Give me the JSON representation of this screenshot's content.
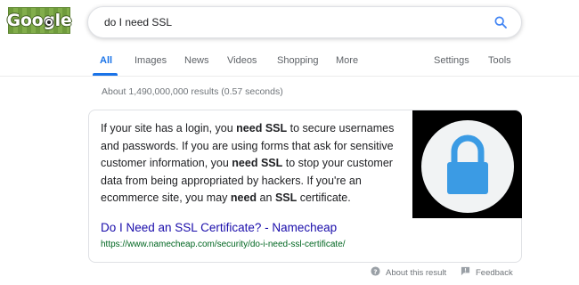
{
  "logo": {
    "text": "Google"
  },
  "search": {
    "query": "do I need SSL"
  },
  "tabs": [
    {
      "label": "All"
    },
    {
      "label": "Images"
    },
    {
      "label": "News"
    },
    {
      "label": "Videos"
    },
    {
      "label": "Shopping"
    },
    {
      "label": "More"
    }
  ],
  "tools": {
    "settings": "Settings",
    "tools": "Tools"
  },
  "results": {
    "stats": "About 1,490,000,000 results (0.57 seconds)"
  },
  "snippet": {
    "segments": [
      {
        "text": "If your site has a login, you "
      },
      {
        "text": "need SSL",
        "bold": true
      },
      {
        "text": " to secure usernames and passwords. If you are using forms that ask for sensitive customer information, you "
      },
      {
        "text": "need SSL",
        "bold": true
      },
      {
        "text": " to stop your customer data from being appropriated by hackers. If you're an ecommerce site, you may "
      },
      {
        "text": "need",
        "bold": true
      },
      {
        "text": " an "
      },
      {
        "text": "SSL",
        "bold": true
      },
      {
        "text": " certificate."
      }
    ],
    "title": "Do I Need an SSL Certificate? - Namecheap",
    "url": "https://www.namecheap.com/security/do-i-need-ssl-certificate/",
    "image_icon": "padlock-icon"
  },
  "footer": {
    "about": "About this result",
    "feedback": "Feedback"
  },
  "colors": {
    "accent": "#1a73e8",
    "link_title": "#1a0dab",
    "link_url": "#006621",
    "padlock": "#3b9be4"
  }
}
